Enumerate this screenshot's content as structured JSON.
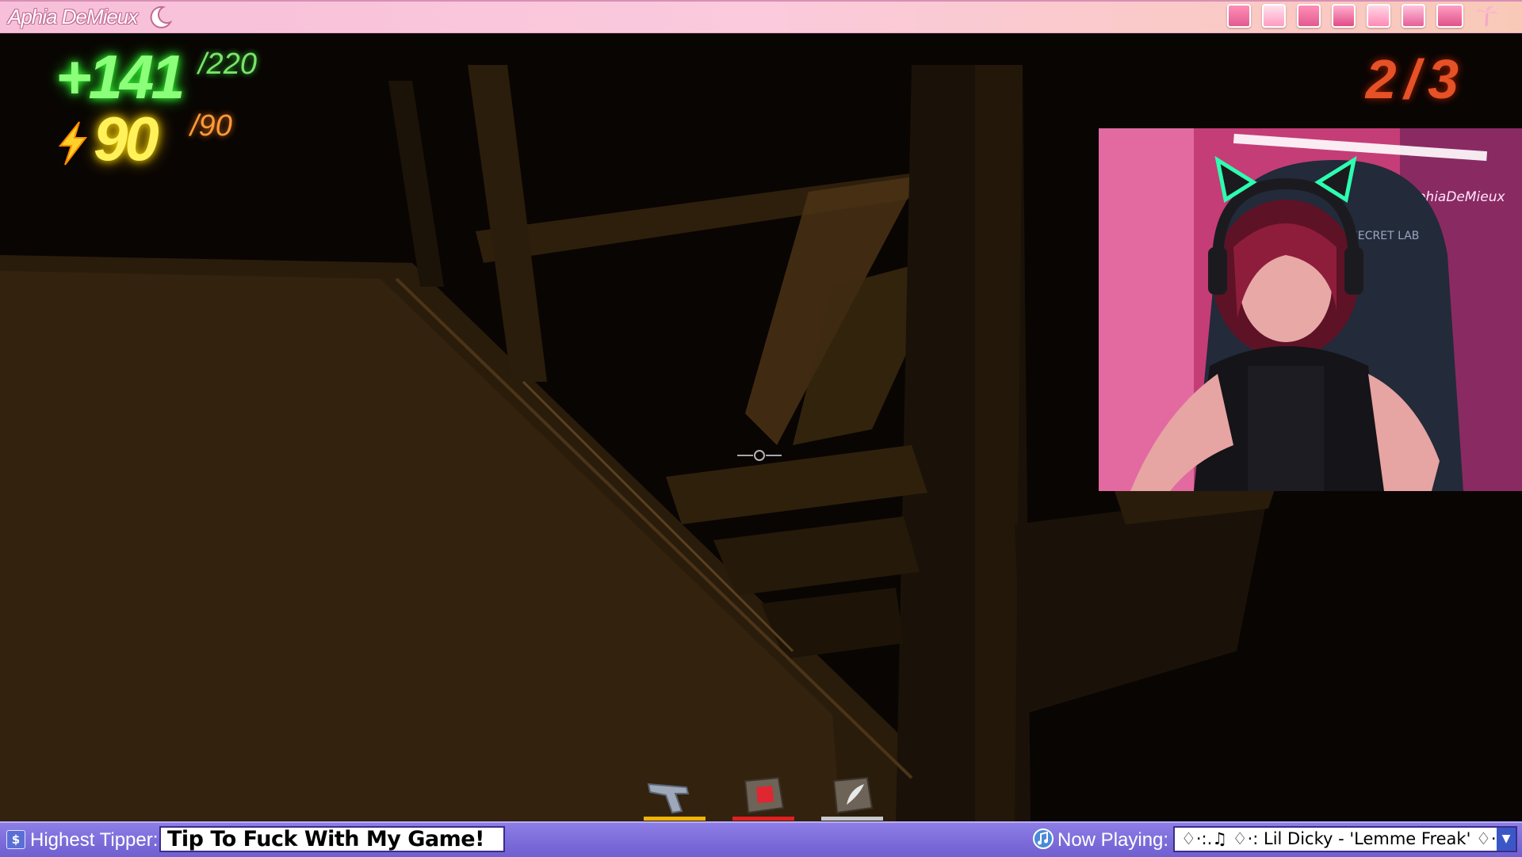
{
  "topbar": {
    "streamer_name": "Aphia DeMieux",
    "icons": [
      "heart-card-icon",
      "notepad-icon",
      "pink-folder-icon",
      "heart-gift-icon",
      "pink-chart-icon",
      "pink-book-icon",
      "pink-keyboard-icon",
      "palm-tree-icon"
    ]
  },
  "hud": {
    "health": "+141",
    "health_max": "/220",
    "energy": "90",
    "energy_max": "/90",
    "counter": "2/3",
    "colors": {
      "health": "#8cff7a",
      "energy": "#fff15a",
      "counter": "#ff5a2a"
    }
  },
  "webcam": {
    "sign_text": "AphiaDeMieux",
    "chair_text": "SECRET LAB"
  },
  "hotbar": {
    "slots": [
      {
        "icon": "pistol-icon",
        "underline": "#f0b400"
      },
      {
        "icon": "red-item-box-icon",
        "underline": "#e0201f"
      },
      {
        "icon": "feather-item-box-icon",
        "underline": "#c9c9c9"
      }
    ]
  },
  "bottombar": {
    "tipper_label": "Highest Tipper:",
    "tipper_value": "Tip To Fuck With My Game!",
    "nowplaying_label": "Now Playing:",
    "song": "♢·:.♫ ♢·:  Lil Dicky - 'Lemme Freak'  ♢·:.♫ ♢·:",
    "accent": "#8d7de6"
  }
}
